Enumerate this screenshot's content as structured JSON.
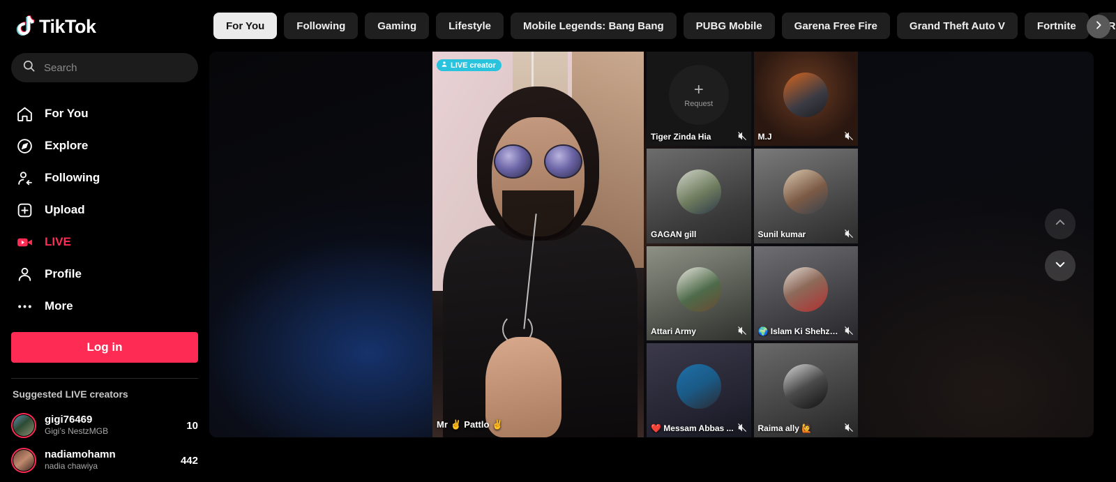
{
  "brand": {
    "name": "TikTok"
  },
  "search": {
    "placeholder": "Search",
    "value": ""
  },
  "sidebar": {
    "items": [
      {
        "label": "For You",
        "icon": "home-icon"
      },
      {
        "label": "Explore",
        "icon": "compass-icon"
      },
      {
        "label": "Following",
        "icon": "following-icon"
      },
      {
        "label": "Upload",
        "icon": "upload-icon"
      },
      {
        "label": "LIVE",
        "icon": "live-camera-icon"
      },
      {
        "label": "Profile",
        "icon": "person-icon"
      },
      {
        "label": "More",
        "icon": "ellipsis-icon"
      }
    ],
    "login_label": "Log in",
    "suggested_title": "Suggested LIVE creators",
    "creators": [
      {
        "name": "gigi76469",
        "display": "Gigi’s NestzMGB",
        "count": "10"
      },
      {
        "name": "nadiamohamn",
        "display": "nadia chawiya",
        "count": "442"
      }
    ]
  },
  "tabs": [
    {
      "label": "For You",
      "active": true
    },
    {
      "label": "Following",
      "active": false
    },
    {
      "label": "Gaming",
      "active": false
    },
    {
      "label": "Lifestyle",
      "active": false
    },
    {
      "label": "Mobile Legends: Bang Bang",
      "active": false
    },
    {
      "label": "PUBG Mobile",
      "active": false
    },
    {
      "label": "Garena Free Fire",
      "active": false
    },
    {
      "label": "Grand Theft Auto V",
      "active": false
    },
    {
      "label": "Fortnite",
      "active": false
    },
    {
      "label": "Roblox",
      "active": false
    }
  ],
  "player": {
    "badge_label": "LIVE creator",
    "badge_color": "#29c3de",
    "username": "Mr ✌ Pattlo ✌"
  },
  "grid": [
    {
      "name": "Tiger Zinda Hia",
      "muted": true,
      "request": true,
      "request_label": "Request"
    },
    {
      "name": "M.J",
      "muted": true,
      "request": false
    },
    {
      "name": "GAGAN gill",
      "muted": false,
      "request": false
    },
    {
      "name": "Sunil kumar",
      "muted": true,
      "request": false
    },
    {
      "name": "Attari Army",
      "muted": true,
      "request": false
    },
    {
      "name": "🌍 Islam Ki Shehza...",
      "muted": true,
      "request": false
    },
    {
      "name": "❤️ Messam Abbas ...",
      "muted": true,
      "request": false
    },
    {
      "name": "Raima ally 🙋",
      "muted": true,
      "request": false
    }
  ],
  "colors": {
    "accent": "#fe2c55",
    "live_badge": "#29c3de",
    "tab_active_bg": "#ebebeb"
  }
}
